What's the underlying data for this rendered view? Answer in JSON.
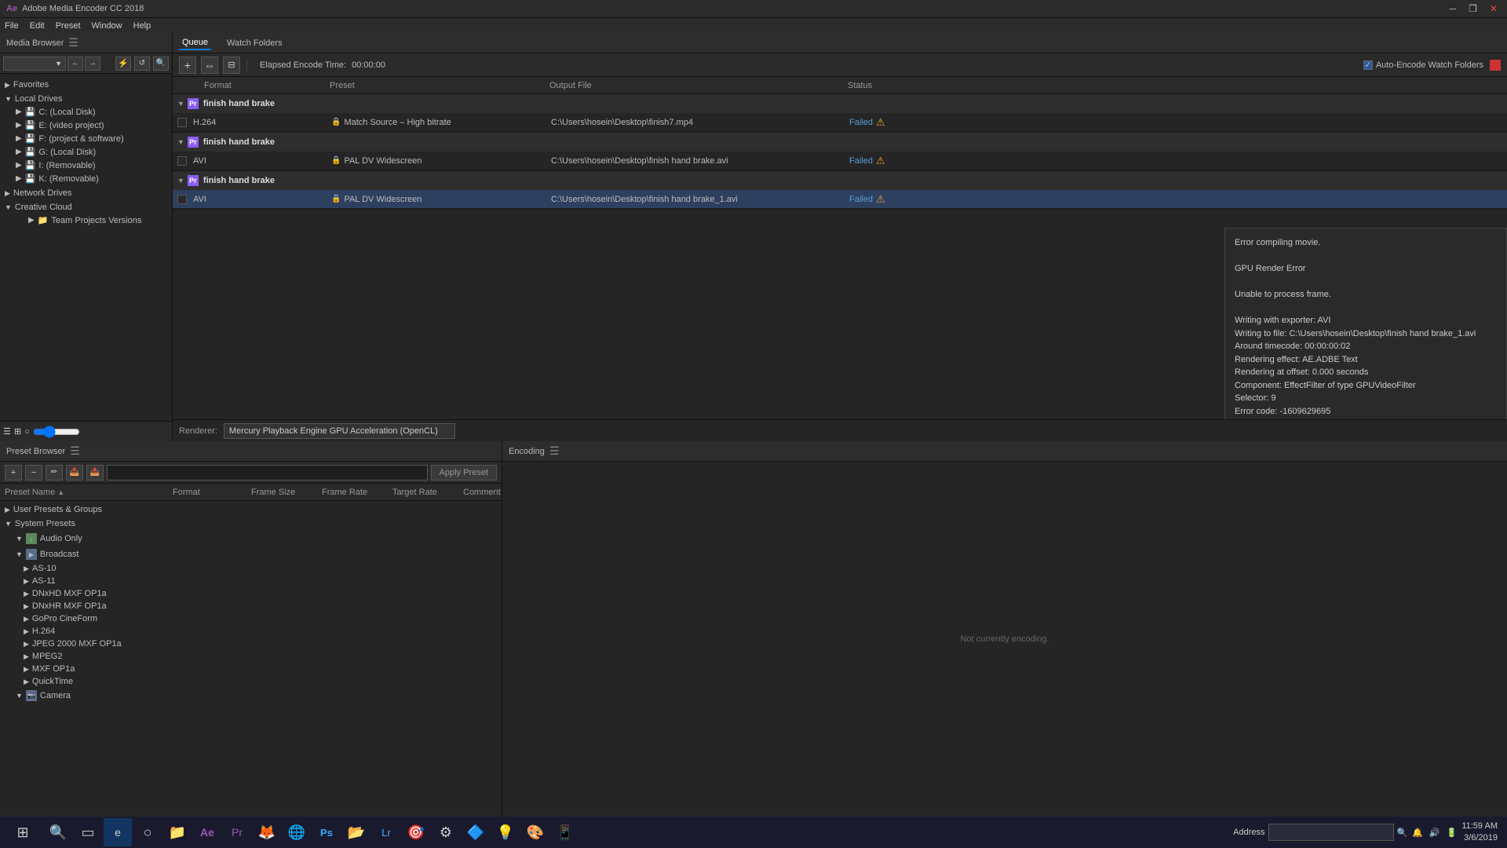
{
  "app": {
    "title": "Adobe Media Encoder CC 2018",
    "logo": "Ae"
  },
  "titlebar": {
    "title": "Adobe Media Encoder CC 2018",
    "minimize": "─",
    "restore": "❐",
    "close": "✕"
  },
  "menubar": {
    "items": [
      "File",
      "Edit",
      "Preset",
      "Window",
      "Help"
    ]
  },
  "mediaBrowser": {
    "header": "Media Browser",
    "toolbar": {
      "dropdown_arrow": "▼",
      "back": "←",
      "forward": "→",
      "filter": "⚡",
      "refresh": "↺",
      "search": "🔍"
    },
    "tree": {
      "favorites": {
        "label": "Favorites",
        "expanded": true
      },
      "localDrives": {
        "label": "Local Drives",
        "expanded": true,
        "items": [
          {
            "label": "C: (Local Disk)",
            "icon": "💾"
          },
          {
            "label": "E: (video project)",
            "icon": "💾"
          },
          {
            "label": "F: (project & software)",
            "icon": "💾"
          },
          {
            "label": "G: (Local Disk)",
            "icon": "💾"
          },
          {
            "label": "I: (Removable)",
            "icon": "💾"
          },
          {
            "label": "K: (Removable)",
            "icon": "💾"
          }
        ]
      },
      "networkDrives": {
        "label": "Network Drives",
        "expanded": false
      },
      "creativeCloud": {
        "label": "Creative Cloud",
        "expanded": true,
        "items": [
          {
            "label": "Team Projects Versions",
            "icon": "📁"
          }
        ]
      }
    }
  },
  "queue": {
    "tab_queue": "Queue",
    "tab_watch": "Watch Folders",
    "elapsed_label": "Elapsed Encode Time:",
    "elapsed_time": "00:00:00",
    "auto_encode_label": "Auto-Encode Watch Folders",
    "headers": {
      "format": "Format",
      "preset": "Preset",
      "output": "Output File",
      "status": "Status"
    },
    "items": [
      {
        "id": 1,
        "title": "finish hand brake",
        "expanded": true,
        "rows": [
          {
            "id": "1a",
            "format": "H.264",
            "preset": "Match Source – High bitrate",
            "output": "C:\\Users\\hosein\\Desktop\\finish7.mp4",
            "status": "Failed"
          }
        ]
      },
      {
        "id": 2,
        "title": "finish hand brake",
        "expanded": true,
        "rows": [
          {
            "id": "2a",
            "format": "AVI",
            "preset": "PAL DV Widescreen",
            "output": "C:\\Users\\hosein\\Desktop\\finish hand brake.avi",
            "status": "Failed"
          }
        ]
      },
      {
        "id": 3,
        "title": "finish hand brake",
        "expanded": true,
        "rows": [
          {
            "id": "3a",
            "format": "AVI",
            "preset": "PAL DV Widescreen",
            "output": "C:\\Users\\hosein\\Desktop\\finish hand brake_1.avi",
            "status": "Failed"
          }
        ]
      }
    ],
    "error": {
      "line1": "Error compiling movie.",
      "line2": "",
      "line3": "GPU Render Error",
      "line4": "",
      "line5": "Unable to process frame.",
      "line6": "",
      "line7": "Writing with exporter: AVI",
      "line8": "Writing to file: C:\\Users\\hosein\\Desktop\\finish hand brake_1.avi",
      "line9": "Around timecode: 00:00:00:02",
      "line10": "Rendering effect: AE.ADBE Text",
      "line11": "Rendering at offset: 0.000 seconds",
      "line12": "Component: EffectFilter of type GPUVideoFilter",
      "line13": "Selector: 9",
      "line14": "Error code: -1609629695"
    },
    "renderer_label": "Renderer:",
    "renderer_value": "Mercury Playback Engine GPU Acceleration (OpenCL)"
  },
  "presetBrowser": {
    "header": "Preset Browser",
    "search_placeholder": "",
    "apply_preset": "Apply Preset",
    "columns": {
      "name": "Preset Name",
      "format": "Format",
      "frame_size": "Frame Size",
      "frame_rate": "Frame Rate",
      "target_rate": "Target Rate",
      "comment": "Comment"
    },
    "tree": {
      "user_presets": {
        "label": "User Presets & Groups",
        "expanded": false
      },
      "system_presets": {
        "label": "System Presets",
        "expanded": true,
        "groups": [
          {
            "label": "Audio Only",
            "icon": "audio",
            "expanded": false
          },
          {
            "label": "Broadcast",
            "icon": "video",
            "expanded": true,
            "items": [
              "AS-10",
              "AS-11",
              "DNxHD MXF OP1a",
              "DNxHR MXF OP1a",
              "GoPro CineForm",
              "H.264",
              "JPEG 2000 MXF OP1a",
              "MPEG2",
              "MXF OP1a",
              "QuickTime"
            ]
          },
          {
            "label": "Camera",
            "icon": "video",
            "expanded": false
          }
        ]
      }
    }
  },
  "encoding": {
    "header": "Encoding",
    "status": "Not currently encoding."
  },
  "taskbar": {
    "start": "⊞",
    "address_label": "Address",
    "time": "11:59 AM",
    "date": "3/6/2019",
    "icons": [
      "←",
      "○",
      "▭",
      "🎮",
      "📋",
      "◈",
      "Ae",
      "📁",
      "🦊",
      "📊",
      "⚙",
      "🎯",
      "🎨",
      "🖼",
      "📸",
      "🎬",
      "🌐",
      "🔷",
      "📱"
    ]
  }
}
